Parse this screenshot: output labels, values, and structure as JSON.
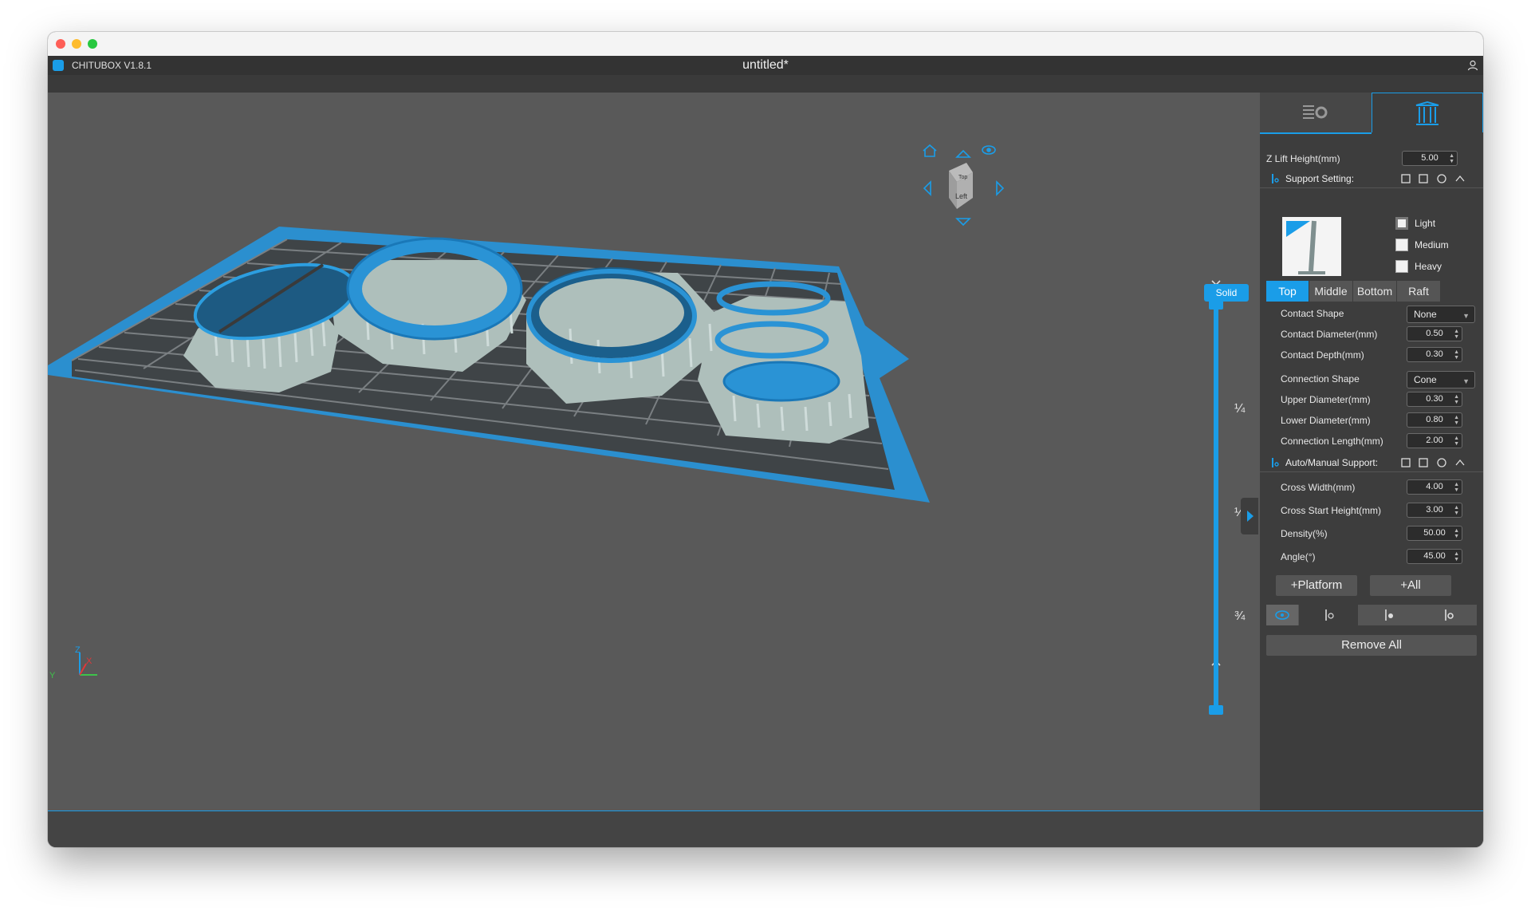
{
  "app": {
    "name": "CHITUBOX V1.8.1",
    "document_title": "untitled*"
  },
  "viewport": {
    "view_cube": {
      "face_label": "Left",
      "top_label": "Top"
    },
    "render_mode": "Solid",
    "layer_slider": {
      "marks": [
        "¼",
        "½",
        "¾"
      ]
    },
    "colors": {
      "model": "#1a9de8",
      "support": "#b7c9c6",
      "background": "#595959"
    }
  },
  "panel": {
    "z_lift": {
      "label": "Z Lift Height(mm)",
      "value": "5.00"
    },
    "support_setting": {
      "title": "Support Setting:"
    },
    "presets": [
      {
        "label": "Light",
        "checked": true
      },
      {
        "label": "Medium",
        "checked": false
      },
      {
        "label": "Heavy",
        "checked": false
      }
    ],
    "segments": [
      "Top",
      "Middle",
      "Bottom",
      "Raft"
    ],
    "active_segment": "Top",
    "fields": {
      "contact_shape": {
        "label": "Contact Shape",
        "value": "None"
      },
      "contact_diameter": {
        "label": "Contact Diameter(mm)",
        "value": "0.50"
      },
      "contact_depth": {
        "label": "Contact Depth(mm)",
        "value": "0.30"
      },
      "connection_shape": {
        "label": "Connection Shape",
        "value": "Cone"
      },
      "upper_diameter": {
        "label": "Upper Diameter(mm)",
        "value": "0.30"
      },
      "lower_diameter": {
        "label": "Lower Diameter(mm)",
        "value": "0.80"
      },
      "connection_length": {
        "label": "Connection Length(mm)",
        "value": "2.00"
      }
    },
    "auto_manual": {
      "title": "Auto/Manual Support:",
      "cross_width": {
        "label": "Cross Width(mm)",
        "value": "4.00"
      },
      "cross_start_height": {
        "label": "Cross Start Height(mm)",
        "value": "3.00"
      },
      "density": {
        "label": "Density(%)",
        "value": "50.00"
      },
      "angle": {
        "label": "Angle(°)",
        "value": "45.00"
      }
    },
    "buttons": {
      "platform": "+Platform",
      "all": "+All",
      "remove_all": "Remove All"
    }
  }
}
